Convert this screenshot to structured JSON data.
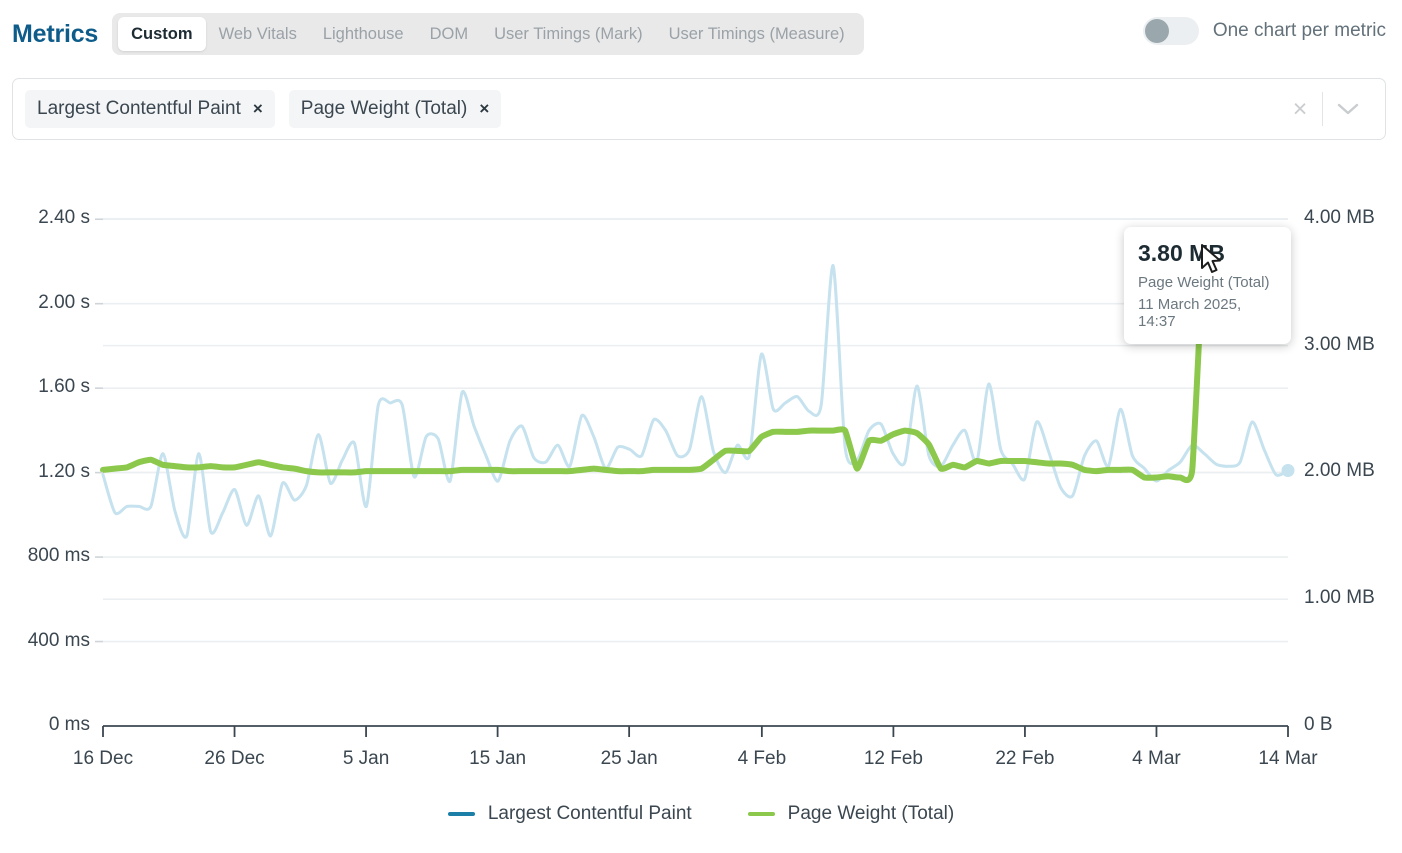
{
  "header": {
    "title": "Metrics",
    "tabs": [
      {
        "label": "Custom",
        "active": true
      },
      {
        "label": "Web Vitals",
        "active": false
      },
      {
        "label": "Lighthouse",
        "active": false
      },
      {
        "label": "DOM",
        "active": false
      },
      {
        "label": "User Timings (Mark)",
        "active": false
      },
      {
        "label": "User Timings (Measure)",
        "active": false
      }
    ],
    "toggle": {
      "label": "One chart per metric",
      "state": "off"
    }
  },
  "metric_select": {
    "chips": [
      {
        "label": "Largest Contentful Paint",
        "remove": "×"
      },
      {
        "label": "Page Weight (Total)",
        "remove": "×"
      }
    ],
    "clear_all": "×",
    "chevron": "chevron-down"
  },
  "tooltip": {
    "value": "3.80 MB",
    "metric": "Page Weight (Total)",
    "date": "11 March 2025, 14:37"
  },
  "colors": {
    "lcp": "#c5e2ee",
    "page_weight": "#8cc84b",
    "lcp_legend": "#1b7fa8",
    "title": "#0e5c8a",
    "grid": "#eceff1",
    "axis": "#3b4750"
  },
  "chart_data": {
    "type": "line",
    "title": "",
    "xlabel": "",
    "grid": true,
    "legend_position": "bottom",
    "x_tick_labels": [
      "16 Dec",
      "26 Dec",
      "5 Jan",
      "15 Jan",
      "25 Jan",
      "4 Feb",
      "12 Feb",
      "22 Feb",
      "4 Mar",
      "14 Mar"
    ],
    "x_tick_positions": [
      0,
      0.111,
      0.222,
      0.333,
      0.444,
      0.556,
      0.667,
      0.778,
      0.889,
      1.0
    ],
    "axes": [
      {
        "side": "left",
        "name": "Largest Contentful Paint",
        "unit": "time",
        "tick_labels": [
          "2.40 s",
          "2.00 s",
          "1.60 s",
          "1.20 s",
          "800 ms",
          "400 ms",
          "0 ms"
        ],
        "tick_values": [
          2400,
          2000,
          1600,
          1200,
          800,
          400,
          0
        ],
        "ylim": [
          0,
          2600
        ]
      },
      {
        "side": "right",
        "name": "Page Weight (Total)",
        "unit": "bytes",
        "tick_labels": [
          "4.00 MB",
          "3.00 MB",
          "2.00 MB",
          "1.00 MB",
          "0 B"
        ],
        "tick_values": [
          4.0,
          3.0,
          2.0,
          1.0,
          0.0
        ],
        "ylim": [
          0,
          4.33
        ]
      }
    ],
    "series": [
      {
        "name": "Largest Contentful Paint",
        "axis": "left",
        "unit": "ms",
        "color": "#c5e2ee",
        "legend_color": "#1b7fa8",
        "line_width": 3,
        "end_marker": true,
        "values": [
          1190,
          1010,
          1040,
          1040,
          1040,
          1290,
          1020,
          900,
          1290,
          920,
          1010,
          1120,
          950,
          1090,
          900,
          1150,
          1070,
          1140,
          1380,
          1150,
          1260,
          1340,
          1040,
          1520,
          1530,
          1520,
          1180,
          1370,
          1360,
          1160,
          1580,
          1420,
          1280,
          1160,
          1350,
          1420,
          1270,
          1250,
          1330,
          1230,
          1470,
          1370,
          1220,
          1320,
          1310,
          1280,
          1450,
          1400,
          1280,
          1310,
          1560,
          1300,
          1200,
          1330,
          1280,
          1760,
          1500,
          1530,
          1560,
          1490,
          1520,
          2180,
          1320,
          1260,
          1400,
          1430,
          1290,
          1250,
          1610,
          1280,
          1230,
          1330,
          1400,
          1250,
          1620,
          1310,
          1240,
          1170,
          1440,
          1300,
          1130,
          1090,
          1280,
          1350,
          1230,
          1500,
          1280,
          1220,
          1160,
          1210,
          1250,
          1330,
          1290,
          1240,
          1230,
          1250,
          1440,
          1310,
          1190,
          1210
        ]
      },
      {
        "name": "Page Weight (Total)",
        "axis": "right",
        "unit": "MB",
        "color": "#8cc84b",
        "legend_color": "#8cc84b",
        "line_width": 6,
        "values": [
          2.02,
          2.03,
          2.04,
          2.08,
          2.1,
          2.06,
          2.05,
          2.04,
          2.04,
          2.05,
          2.04,
          2.04,
          2.06,
          2.08,
          2.06,
          2.04,
          2.03,
          2.01,
          2.0,
          2.0,
          2.0,
          2.0,
          2.01,
          2.01,
          2.01,
          2.01,
          2.01,
          2.01,
          2.01,
          2.01,
          2.02,
          2.02,
          2.02,
          2.02,
          2.01,
          2.01,
          2.01,
          2.01,
          2.01,
          2.01,
          2.02,
          2.03,
          2.02,
          2.01,
          2.01,
          2.01,
          2.02,
          2.02,
          2.02,
          2.02,
          2.03,
          2.1,
          2.17,
          2.17,
          2.17,
          2.28,
          2.32,
          2.32,
          2.32,
          2.33,
          2.33,
          2.33,
          2.33,
          2.03,
          2.25,
          2.25,
          2.3,
          2.33,
          2.31,
          2.22,
          2.03,
          2.06,
          2.04,
          2.09,
          2.07,
          2.09,
          2.09,
          2.09,
          2.08,
          2.07,
          2.07,
          2.06,
          2.02,
          2.01,
          2.02,
          2.02,
          2.02,
          1.96,
          1.96,
          1.97,
          1.96,
          2.02,
          3.8,
          3.78,
          3.78,
          3.76,
          3.72,
          3.7,
          3.7,
          3.7
        ]
      }
    ],
    "highlight_point": {
      "series": "Page Weight (Total)",
      "index": 92,
      "value": 3.8,
      "label": "3.80 MB",
      "date": "11 March 2025, 14:37",
      "marker": "diamond"
    }
  },
  "legend": [
    {
      "label": "Largest Contentful Paint",
      "color": "#1b7fa8"
    },
    {
      "label": "Page Weight (Total)",
      "color": "#8cc84b"
    }
  ]
}
